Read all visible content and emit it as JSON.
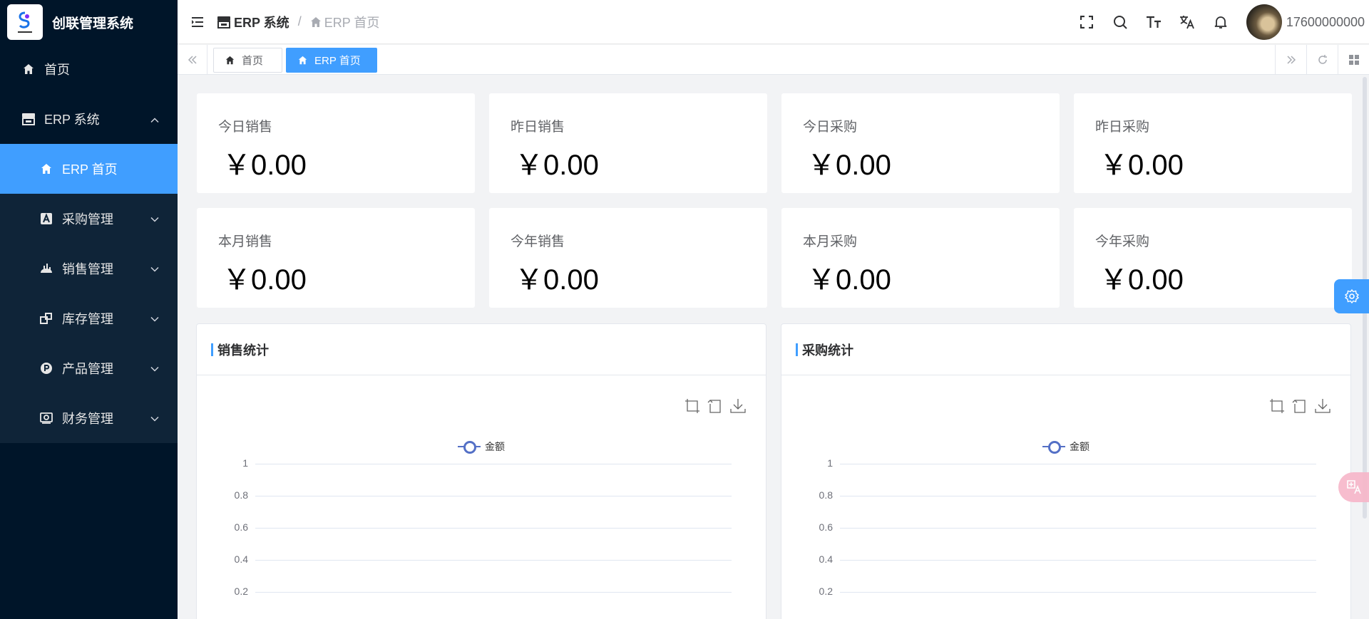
{
  "app": {
    "name": "创联管理系统"
  },
  "sidebar": {
    "items": [
      {
        "label": "首页",
        "icon": "home-icon"
      },
      {
        "label": "ERP 系统",
        "icon": "store-icon",
        "expanded": true,
        "children": [
          {
            "label": "ERP 首页",
            "icon": "home-icon",
            "active": true
          },
          {
            "label": "采购管理",
            "icon": "purchase-icon"
          },
          {
            "label": "销售管理",
            "icon": "sales-icon"
          },
          {
            "label": "库存管理",
            "icon": "inventory-icon"
          },
          {
            "label": "产品管理",
            "icon": "product-icon"
          },
          {
            "label": "财务管理",
            "icon": "finance-icon"
          }
        ]
      }
    ]
  },
  "header": {
    "breadcrumb": [
      "ERP 系统",
      "ERP 首页"
    ],
    "breadcrumb_sep": "/",
    "user": "17600000000"
  },
  "tags": [
    "首页",
    "ERP 首页"
  ],
  "stats": [
    {
      "label": "今日销售",
      "value": "￥0.00"
    },
    {
      "label": "昨日销售",
      "value": "￥0.00"
    },
    {
      "label": "今日采购",
      "value": "￥0.00"
    },
    {
      "label": "昨日采购",
      "value": "￥0.00"
    },
    {
      "label": "本月销售",
      "value": "￥0.00"
    },
    {
      "label": "今年销售",
      "value": "￥0.00"
    },
    {
      "label": "本月采购",
      "value": "￥0.00"
    },
    {
      "label": "今年采购",
      "value": "￥0.00"
    }
  ],
  "panels": [
    {
      "title": "销售统计",
      "legend": "金额"
    },
    {
      "title": "采购统计",
      "legend": "金额"
    }
  ],
  "chart_data": [
    {
      "type": "line",
      "series": [
        {
          "name": "金额",
          "values": []
        }
      ],
      "y_ticks": [
        "1",
        "0.8",
        "0.6",
        "0.4",
        "0.2"
      ],
      "ylim": [
        0,
        1
      ]
    },
    {
      "type": "line",
      "series": [
        {
          "name": "金额",
          "values": []
        }
      ],
      "y_ticks": [
        "1",
        "0.8",
        "0.6",
        "0.4",
        "0.2"
      ],
      "ylim": [
        0,
        1
      ]
    }
  ],
  "colors": {
    "accent": "#409eff",
    "sidebar": "#001529",
    "series": "#5470c6"
  }
}
